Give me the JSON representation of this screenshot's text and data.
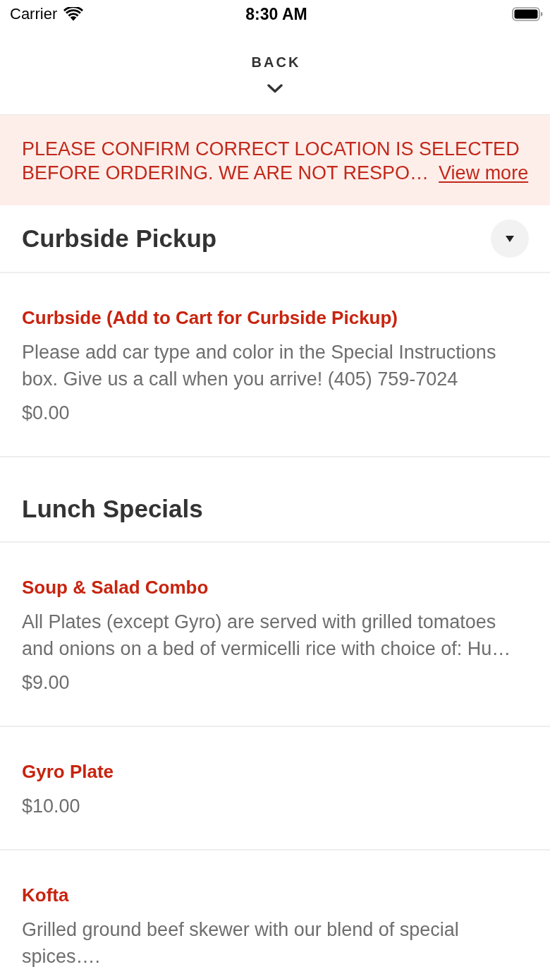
{
  "status_bar": {
    "carrier": "Carrier",
    "time": "8:30 AM"
  },
  "header": {
    "back_label": "BACK"
  },
  "notice": {
    "message": "PLEASE CONFIRM CORRECT LOCATION IS SELECTED BEFORE ORDERING. WE ARE NOT RESPO…",
    "link": "View more"
  },
  "sections": [
    {
      "title": "Curbside Pickup",
      "collapse_button": true,
      "items": [
        {
          "name": "Curbside (Add to Cart for Curbside Pickup)",
          "description": "Please add car type and color in the Special Instructions box. Give us a call when you arrive! (405) 759-7024",
          "price": "$0.00"
        }
      ]
    },
    {
      "title": "Lunch Specials",
      "collapse_button": false,
      "items": [
        {
          "name": "Soup & Salad Combo",
          "description": "All Plates (except Gyro) are served with grilled tomatoes and onions on a bed of vermicelli rice with choice of: Hu…",
          "price": "$9.00"
        },
        {
          "name": "Gyro Plate",
          "price": "$10.00"
        },
        {
          "name": "Kofta",
          "description": "Grilled ground beef skewer with our blend of special spices…."
        }
      ]
    }
  ]
}
